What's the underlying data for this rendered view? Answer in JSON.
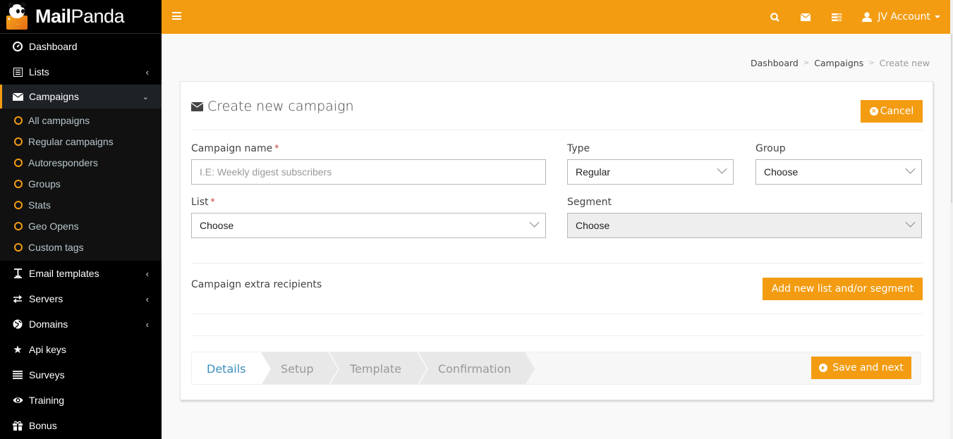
{
  "app": {
    "brand_bold": "Mail",
    "brand_light": "Panda",
    "accent_color": "#f39c12"
  },
  "sidebar": {
    "items": [
      {
        "label": "Dashboard",
        "icon": "dashboard-icon",
        "has_chevron": false
      },
      {
        "label": "Lists",
        "icon": "list-icon",
        "has_chevron": true
      },
      {
        "label": "Campaigns",
        "icon": "envelope-icon",
        "has_chevron": true,
        "active": true,
        "expanded": true
      },
      {
        "label": "Email templates",
        "icon": "text-cursor-icon",
        "has_chevron": true
      },
      {
        "label": "Servers",
        "icon": "exchange-icon",
        "has_chevron": true
      },
      {
        "label": "Domains",
        "icon": "globe-icon",
        "has_chevron": true
      },
      {
        "label": "Api keys",
        "icon": "star-icon",
        "has_chevron": false
      },
      {
        "label": "Surveys",
        "icon": "list-lines-icon",
        "has_chevron": false
      },
      {
        "label": "Training",
        "icon": "eye-icon",
        "has_chevron": false
      },
      {
        "label": "Bonus",
        "icon": "gift-icon",
        "has_chevron": false
      }
    ],
    "campaign_submenu": [
      {
        "label": "All campaigns"
      },
      {
        "label": "Regular campaigns"
      },
      {
        "label": "Autoresponders"
      },
      {
        "label": "Groups"
      },
      {
        "label": "Stats"
      },
      {
        "label": "Geo Opens"
      },
      {
        "label": "Custom tags"
      }
    ]
  },
  "header": {
    "icons": [
      "search-icon",
      "envelope-icon",
      "tasks-icon"
    ],
    "account_label": "JV Account"
  },
  "breadcrumb": {
    "items": [
      "Dashboard",
      "Campaigns",
      "Create new"
    ],
    "separator": ">"
  },
  "card": {
    "title": "Create new campaign",
    "cancel_label": "Cancel",
    "fields": {
      "campaign_name": {
        "label": "Campaign name",
        "required": "*",
        "value": "",
        "placeholder": "I.E: Weekly digest subscribers"
      },
      "type": {
        "label": "Type",
        "value": "Regular"
      },
      "group": {
        "label": "Group",
        "value": "Choose"
      },
      "list": {
        "label": "List",
        "required": "*",
        "value": "Choose"
      },
      "segment": {
        "label": "Segment",
        "value": "Choose",
        "disabled": true
      }
    },
    "extra_recipients_label": "Campaign extra recipients",
    "add_list_button": "Add new list and/or segment",
    "wizard": {
      "steps": [
        "Details",
        "Setup",
        "Template",
        "Confirmation"
      ],
      "active_step": "Details",
      "save_button": "Save and next"
    }
  }
}
